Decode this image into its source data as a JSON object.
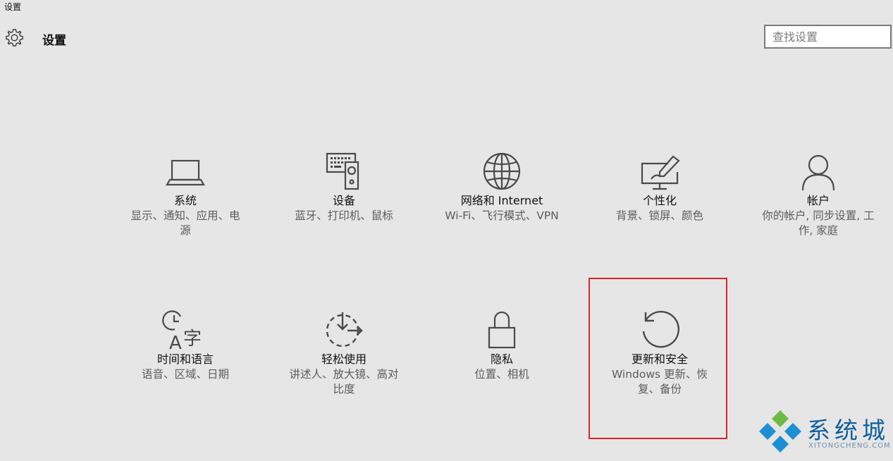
{
  "window": {
    "title": "设置"
  },
  "header": {
    "title": "设置",
    "icon": "gear-icon"
  },
  "search": {
    "placeholder": "查找设置",
    "value": ""
  },
  "tiles": [
    {
      "icon": "laptop-icon",
      "title": "系统",
      "desc": "显示、通知、应用、电\n源"
    },
    {
      "icon": "keyboard-speaker-icon",
      "title": "设备",
      "desc": "蓝牙、打印机、鼠标"
    },
    {
      "icon": "globe-icon",
      "title": "网络和 Internet",
      "desc": "Wi-Fi、飞行模式、VPN"
    },
    {
      "icon": "personalization-icon",
      "title": "个性化",
      "desc": "背景、锁屏、颜色"
    },
    {
      "icon": "person-icon",
      "title": "帐户",
      "desc": "你的帐户, 同步设置, 工\n作, 家庭"
    },
    {
      "icon": "time-language-icon",
      "title": "时间和语言",
      "desc": "语音、区域、日期"
    },
    {
      "icon": "ease-of-access-icon",
      "title": "轻松使用",
      "desc": "讲述人、放大镜、高对\n比度"
    },
    {
      "icon": "lock-icon",
      "title": "隐私",
      "desc": "位置、相机"
    },
    {
      "icon": "refresh-icon",
      "title": "更新和安全",
      "desc": "Windows 更新、恢\n复、备份"
    }
  ],
  "highlight": {
    "color": "#d8262e"
  },
  "watermark": {
    "text": "系统城",
    "subtext": "XITONGCHENG.COM"
  },
  "colors": {
    "background": "#e6e6e6",
    "icon": "#4a4a4a",
    "watermark_blue": "#0d5f9f",
    "watermark_green": "#6dbb45"
  }
}
